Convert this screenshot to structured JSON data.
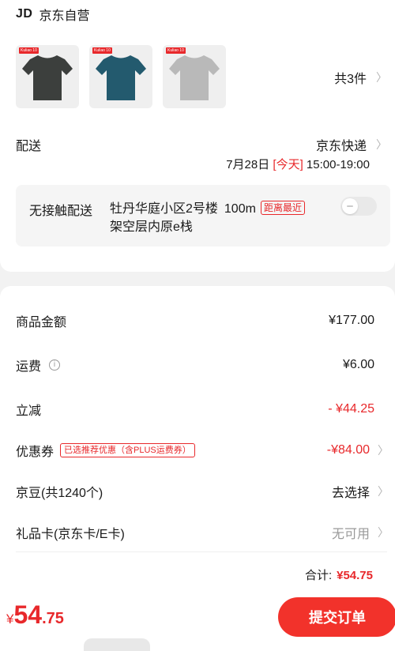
{
  "shop": {
    "logo": "JD",
    "name": "京东自营"
  },
  "products": {
    "items": [
      {
        "color": "#3c3f3d",
        "tag": "Kuliao 10"
      },
      {
        "color": "#235a6e",
        "tag": "Kuliao 10"
      },
      {
        "color": "#b9b9b9",
        "tag": "Kuliao 10"
      }
    ],
    "count_label": "共3件"
  },
  "shipping": {
    "label": "配送",
    "method": "京东快递",
    "date": "7月28日",
    "today": "[今天]",
    "time": "15:00-19:00"
  },
  "contactless": {
    "label": "无接触配送",
    "address_line1": "牡丹华庭小区2号楼",
    "distance": "100m",
    "badge": "距离最近",
    "address_line2": "架空层内原e栈",
    "toggle_on": false
  },
  "fees": {
    "goods_amount_label": "商品金额",
    "goods_amount": "¥177.00",
    "freight_label": "运费",
    "freight": "¥6.00",
    "discount_label": "立减",
    "discount": "- ¥44.25",
    "coupon_label": "优惠券",
    "coupon_badge": "已选推荐优惠（含PLUS运费券）",
    "coupon_value": "-¥84.00",
    "beans_label": "京豆(共1240个)",
    "beans_action": "去选择",
    "giftcard_label": "礼品卡(京东卡/E卡)",
    "giftcard_value": "无可用",
    "total_label": "合计:",
    "total_value": "¥54.75"
  },
  "bottom_bar": {
    "currency": "¥",
    "price_int": "54",
    "price_dec": ".75",
    "submit_label": "提交订单"
  },
  "colors": {
    "accent": "#e8282b",
    "button": "#f2322b"
  }
}
